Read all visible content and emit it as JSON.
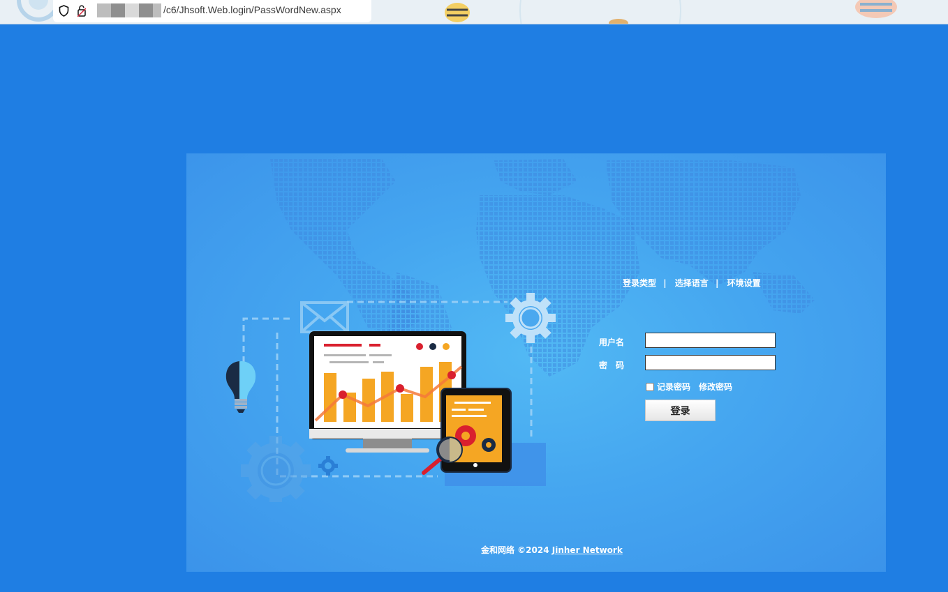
{
  "browser": {
    "url": "/c6/Jhsoft.Web.login/PassWordNew.aspx"
  },
  "login": {
    "links": {
      "login_type": "登录类型",
      "sep1": "|",
      "select_language": "选择语言",
      "sep2": "|",
      "environment_settings": "环境设置"
    },
    "username_label": "用户名",
    "username_value": "",
    "password_label": "密　码",
    "password_value": "",
    "remember_label": "记录密码",
    "remember_checked": false,
    "change_password": "修改密码",
    "submit_label": "登录"
  },
  "footer": {
    "text": "金和网络 ©2024 ",
    "link": "Jinher Network"
  },
  "colors": {
    "page_background": "#1f7ee3",
    "panel_gradient_center": "#52b9f4",
    "panel_gradient_edge": "#3b93ea",
    "chart_orange": "#f5a623",
    "accent_red": "#d9202e"
  },
  "icons": [
    "shield-icon",
    "lock-icon",
    "lightbulb-icon",
    "gear-icon",
    "envelope-icon",
    "monitor-chart-illustration",
    "tablet-icon",
    "magnifier-icon"
  ]
}
